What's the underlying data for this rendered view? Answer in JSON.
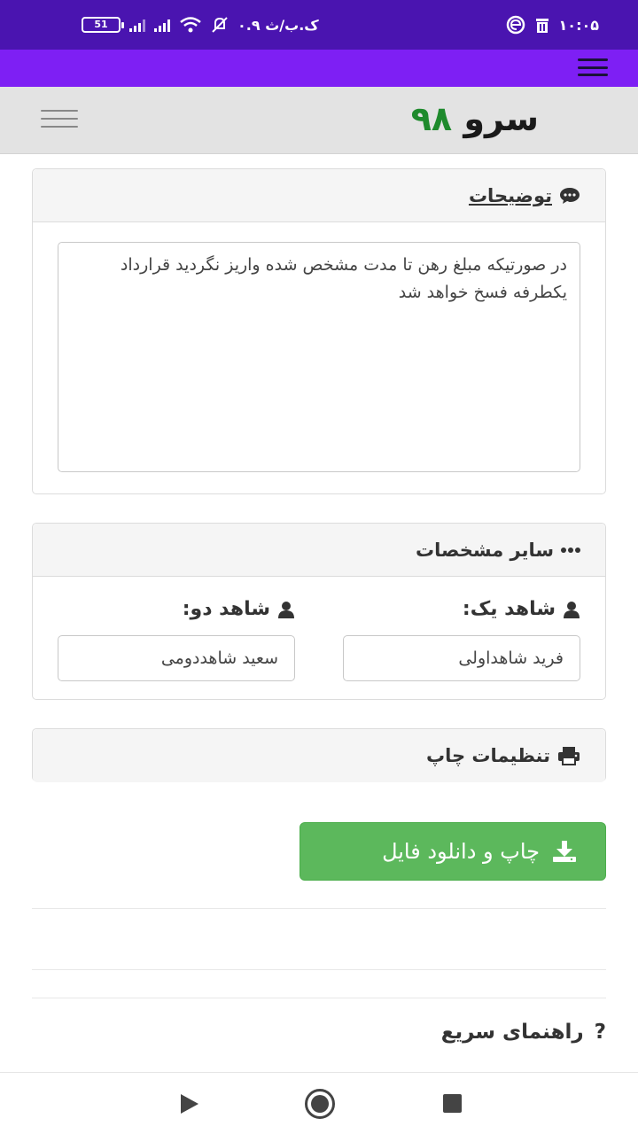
{
  "status_bar": {
    "battery": "51",
    "network_text": "۰.۹ ک.ب/ث",
    "time": "۱۰:۰۵",
    "icons": [
      "battery-icon",
      "signal-icon",
      "signal-icon",
      "wifi-icon",
      "mute-icon",
      "browser-icon",
      "trash-icon"
    ]
  },
  "header": {
    "logo_word": "سرو",
    "logo_number": "۹۸"
  },
  "notes_panel": {
    "title": "توضیحات",
    "icon": "comment-icon",
    "text": "در صورتیکه مبلغ رهن تا مدت مشخص شده واریز نگردید قرارداد یکطرفه فسخ خواهد شد"
  },
  "other_panel": {
    "title": "سایر مشخصات",
    "icon": "ellipsis-icon",
    "witness1_label": "شاهد یک:",
    "witness1_value": "فرید شاهداولی",
    "witness2_label": "شاهد دو:",
    "witness2_value": "سعید شاهددومی"
  },
  "print_panel": {
    "title": "تنظیمات چاپ",
    "icon": "printer-icon"
  },
  "download_button": {
    "label": "چاپ و دانلود فایل",
    "icon": "download-icon"
  },
  "quick_help": {
    "title": "راهنمای سریع",
    "icon_glyph": "?"
  },
  "colors": {
    "status_bar": "#4a14b0",
    "top_bar": "#7e1ff4",
    "logo_number": "#1e8a2c",
    "button": "#5cb85c"
  }
}
